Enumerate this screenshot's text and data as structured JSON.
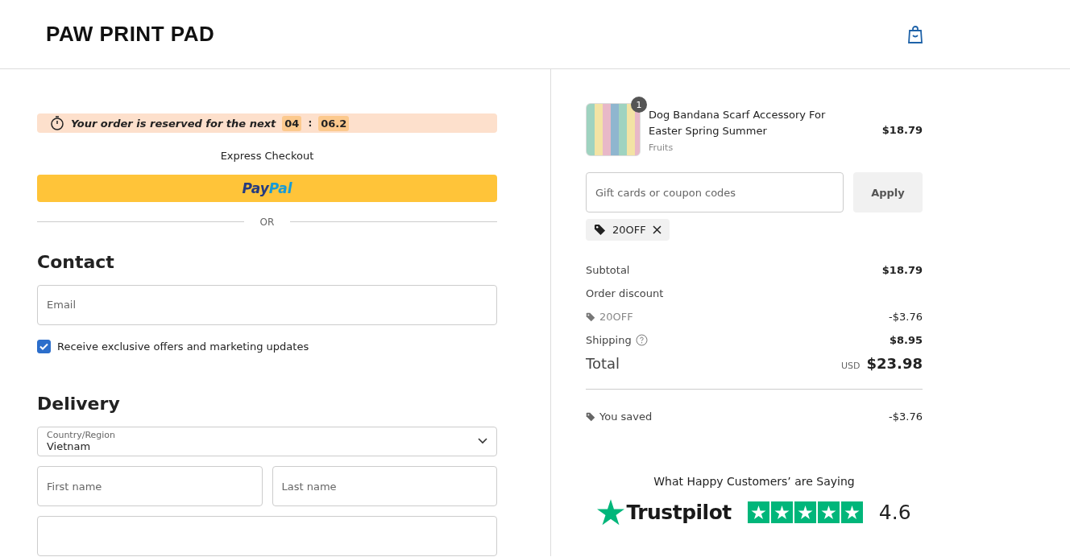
{
  "header": {
    "logo": "PAW PRINT PAD"
  },
  "timer": {
    "text": "Your order is reserved for the next",
    "minutes": "04",
    "separator": ":",
    "seconds": "06.2"
  },
  "express_checkout": {
    "title": "Express Checkout",
    "paypal_parts": [
      "Pay",
      "Pal"
    ],
    "divider": "OR"
  },
  "contact": {
    "title": "Contact",
    "email": {
      "placeholder": "Email"
    },
    "marketing": {
      "label": "Receive exclusive offers and marketing updates",
      "checked": true
    }
  },
  "delivery": {
    "title": "Delivery",
    "country": {
      "label": "Country/Region",
      "value": "Vietnam"
    },
    "first_name": {
      "placeholder": "First name"
    },
    "last_name": {
      "placeholder": "Last name"
    }
  },
  "cart": {
    "items": [
      {
        "name": "Dog Bandana Scarf Accessory For Easter Spring Summer",
        "variant": "Fruits",
        "quantity": "1",
        "price": "$18.79"
      }
    ]
  },
  "coupon": {
    "placeholder": "Gift cards or coupon codes",
    "button": "Apply",
    "applied": [
      "20OFF"
    ]
  },
  "summary": {
    "subtotal_label": "Subtotal",
    "subtotal": "$18.79",
    "discount_label": "Order discount",
    "discount_code": "20OFF",
    "discount": "-$3.76",
    "shipping_label": "Shipping",
    "shipping": "$8.95",
    "total_label": "Total",
    "currency": "USD",
    "total": "$23.98",
    "saved_label": "You saved",
    "saved": "-$3.76"
  },
  "reviews": {
    "title": "What Happy Customers’ are Saying",
    "brand": "Trustpilot",
    "rating": "4.6"
  }
}
